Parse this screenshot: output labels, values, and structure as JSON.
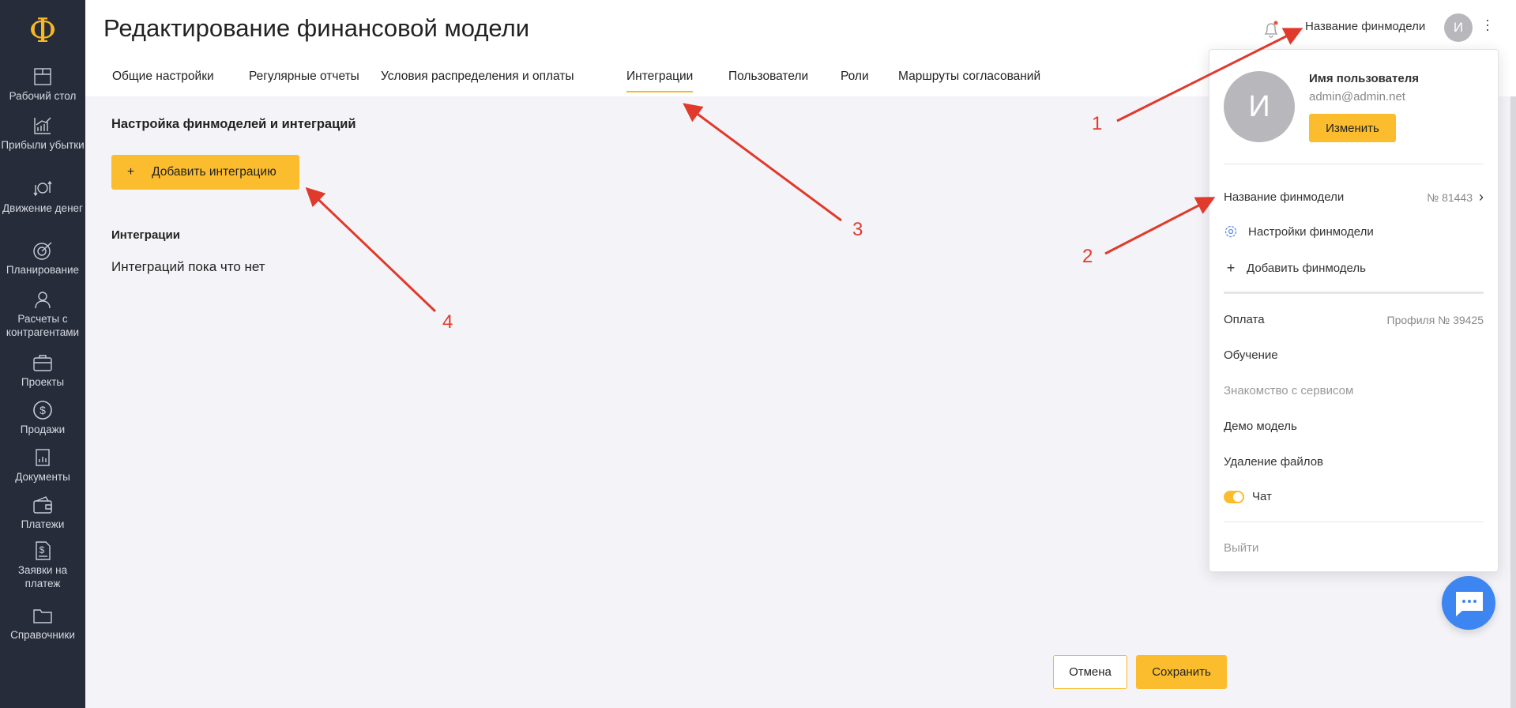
{
  "sidebar": {
    "logo": "Ф",
    "items": [
      {
        "label": "Рабочий стол",
        "icon": "dashboard-icon"
      },
      {
        "label": "Прибыли убытки",
        "icon": "chart-icon"
      },
      {
        "label": "Движение денег",
        "icon": "money-flow-icon"
      },
      {
        "label": "Планирование",
        "icon": "target-icon"
      },
      {
        "label": "Расчеты с контрагентами",
        "icon": "people-icon"
      },
      {
        "label": "Проекты",
        "icon": "briefcase-icon"
      },
      {
        "label": "Продажи",
        "icon": "dollar-icon"
      },
      {
        "label": "Документы",
        "icon": "document-icon"
      },
      {
        "label": "Платежи",
        "icon": "wallet-icon"
      },
      {
        "label": "Заявки на платеж",
        "icon": "invoice-icon"
      },
      {
        "label": "Справочники",
        "icon": "folder-icon"
      }
    ]
  },
  "header": {
    "title": "Редактирование финансовой модели",
    "model_name": "Название финмодели",
    "avatar_letter": "И",
    "tabs": [
      "Общие настройки",
      "Регулярные отчеты",
      "Условия распределения и оплаты",
      "Интеграции",
      "Пользователи",
      "Роли",
      "Маршруты согласований"
    ],
    "active_tab": "Интеграции"
  },
  "main": {
    "section_title": "Настройка финмоделей и интеграций",
    "add_button": "Добавить интеграцию",
    "add_icon": "+",
    "subheading": "Интеграции",
    "empty_text": "Интеграций пока что нет"
  },
  "footer": {
    "cancel": "Отмена",
    "save": "Сохранить"
  },
  "dropdown": {
    "avatar_letter": "И",
    "user_name": "Имя пользователя",
    "email": "admin@admin.net",
    "edit_button": "Изменить",
    "model_name": "Название финмодели",
    "model_number": "№ 81443",
    "settings": "Настройки финмодели",
    "add_model": "Добавить финмодель",
    "add_icon": "+",
    "payment": "Оплата",
    "profile_number": "Профиля № 39425",
    "learning": "Обучение",
    "intro": "Знакомство с сервисом",
    "demo": "Демо модель",
    "delete_files": "Удаление файлов",
    "chat": "Чат",
    "chat_enabled": true,
    "logout": "Выйти"
  },
  "annotations": [
    "1",
    "2",
    "3",
    "4"
  ],
  "colors": {
    "accent": "#fbbd2e",
    "sidebar": "#272c3a",
    "chat": "#3d86f2",
    "annotation": "#e03a2c"
  }
}
